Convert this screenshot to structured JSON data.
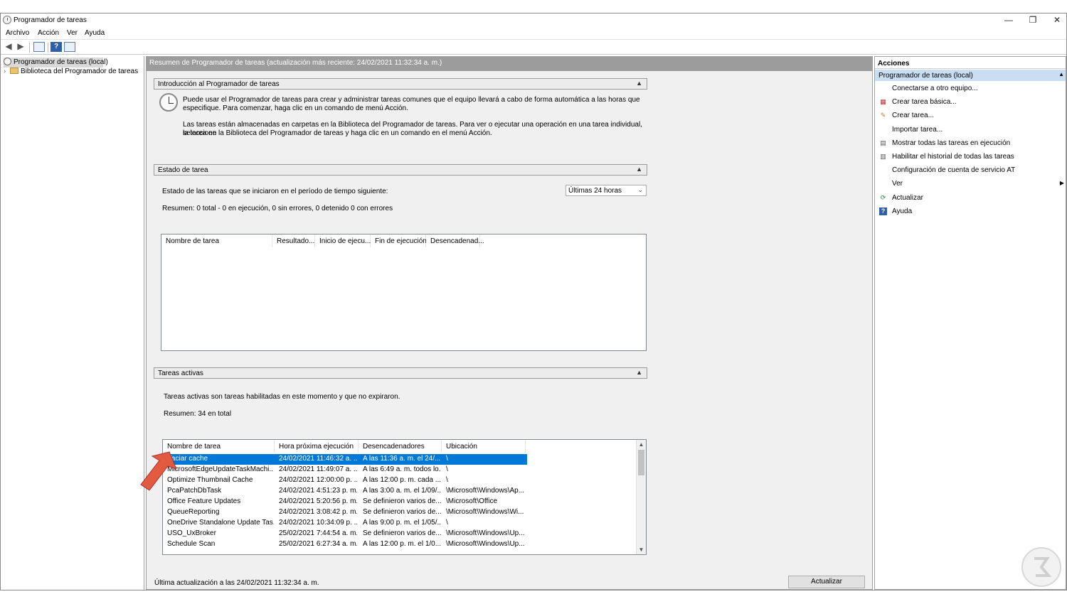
{
  "window": {
    "title": "Programador de tareas",
    "controls": {
      "minimize": "—",
      "restore": "❐",
      "close": "✕"
    }
  },
  "menu": [
    "Archivo",
    "Acción",
    "Ver",
    "Ayuda"
  ],
  "tree": {
    "root": "Programador de tareas (local)",
    "child": "Biblioteca del Programador de tareas"
  },
  "center": {
    "header": "Resumen de Programador de tareas (actualización más reciente: 24/02/2021 11:32:34 a. m.)",
    "intro": {
      "title": "Introducción al Programador de tareas",
      "p1_line1": "Puede usar el Programador de tareas para crear y administrar tareas comunes que el equipo llevará a cabo de forma automática a las horas que",
      "p1_line2": "especifique. Para comenzar, haga clic en un comando de menú Acción.",
      "p2_line1": "Las tareas están almacenadas en carpetas en la Biblioteca del Programador de tareas. Para ver o ejecutar una operación en una tarea individual, seleccione",
      "p2_line2": "la tarea en la Biblioteca del Programador de tareas y haga clic en un comando en el menú Acción."
    },
    "status": {
      "title": "Estado de tarea",
      "period_label": "Estado de las tareas que se iniciaron en el período de tiempo siguiente:",
      "period_value": "Últimas 24 horas",
      "summary": "Resumen: 0 total - 0 en ejecución, 0 sin errores, 0 detenido  0 con errores",
      "columns": [
        "Nombre de tarea",
        "Resultado...",
        "Inicio de ejecu...",
        "Fin de ejecución",
        "Desencadenad..."
      ]
    },
    "active": {
      "title": "Tareas activas",
      "description": "Tareas activas son tareas habilitadas en este momento y que no expiraron.",
      "summary": "Resumen: 34 en total",
      "columns": [
        "Nombre de tarea",
        "Hora próxima ejecución",
        "Desencadenadores",
        "Ubicación"
      ],
      "rows": [
        {
          "name": "Vaciar cache",
          "next": "24/02/2021 11:46:32 a. ...",
          "trigger": "A las 11:36 a. m. el 24/...",
          "location": "\\"
        },
        {
          "name": "MicrosoftEdgeUpdateTaskMachi...",
          "next": "24/02/2021 11:49:07 a. ...",
          "trigger": "A las 6:49 a. m. todos lo...",
          "location": "\\"
        },
        {
          "name": "Optimize Thumbnail Cache",
          "next": "24/02/2021 12:00:00 p. ...",
          "trigger": "A las 12:00 p. m. cada ...",
          "location": "\\"
        },
        {
          "name": "PcaPatchDbTask",
          "next": "24/02/2021 4:51:23 p. m.",
          "trigger": "A las 3:00 a. m. el 1/09/...",
          "location": "\\Microsoft\\Windows\\Ap..."
        },
        {
          "name": "Office Feature Updates",
          "next": "24/02/2021 5:20:56 p. m.",
          "trigger": "Se definieron varios de...",
          "location": "\\Microsoft\\Office"
        },
        {
          "name": "QueueReporting",
          "next": "24/02/2021 3:08:42 p. m.",
          "trigger": "Se definieron varios de...",
          "location": "\\Microsoft\\Windows\\Wi..."
        },
        {
          "name": "OneDrive Standalone Update Tas...",
          "next": "24/02/2021 10:34:09 p. ...",
          "trigger": "A las 9:00 p. m. el 1/05/...",
          "location": "\\"
        },
        {
          "name": "USO_UxBroker",
          "next": "25/02/2021 7:44:54 a. m.",
          "trigger": "Se definieron varios de...",
          "location": "\\Microsoft\\Windows\\Up..."
        },
        {
          "name": "Schedule Scan",
          "next": "25/02/2021 6:27:34 a. m.",
          "trigger": "A las 12:00 p. m. el 1/0...",
          "location": "\\Microsoft\\Windows\\Up..."
        }
      ]
    },
    "footer": "Última actualización a las 24/02/2021 11:32:34 a. m.",
    "refresh_button": "Actualizar"
  },
  "actions": {
    "title": "Acciones",
    "group": "Programador de tareas (local)",
    "items": [
      {
        "label": "Conectarse a otro equipo...",
        "icon": ""
      },
      {
        "label": "Crear tarea básica...",
        "icon": "calendar-icon"
      },
      {
        "label": "Crear tarea...",
        "icon": "task-icon"
      },
      {
        "label": "Importar tarea...",
        "icon": ""
      },
      {
        "label": "Mostrar todas las tareas en ejecución",
        "icon": "list-icon"
      },
      {
        "label": "Habilitar el historial de todas las tareas",
        "icon": "history-icon"
      },
      {
        "label": "Configuración de cuenta de servicio AT",
        "icon": ""
      },
      {
        "label": "Ver",
        "icon": ""
      },
      {
        "label": "Actualizar",
        "icon": "refresh-icon"
      },
      {
        "label": "Ayuda",
        "icon": "help-icon"
      }
    ]
  }
}
